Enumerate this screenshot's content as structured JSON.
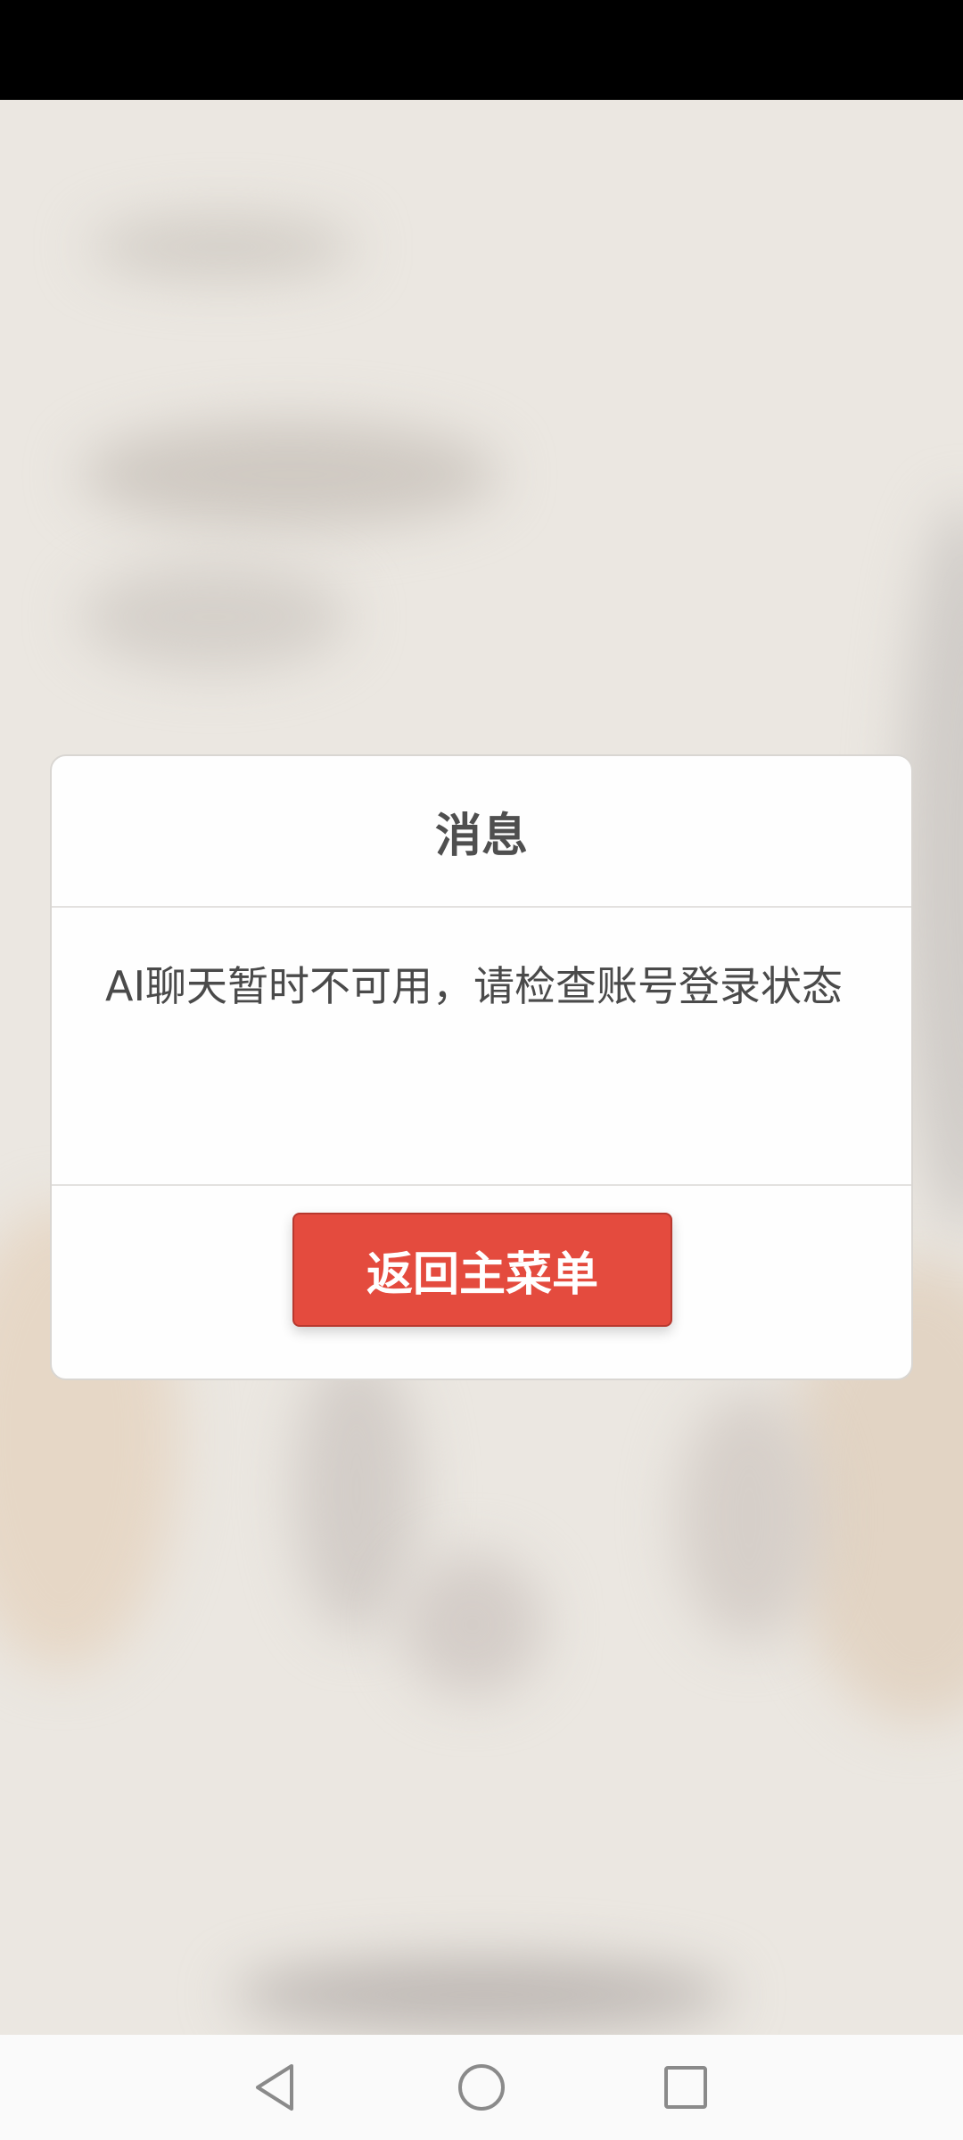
{
  "dialog": {
    "title": "消息",
    "message": "AI聊天暂时不可用，请检查账号登录状态",
    "return_button_label": "返回主菜单"
  },
  "colors": {
    "accent_button": "#e44b3e",
    "status_bar": "#000000",
    "nav_bar": "#fafafa"
  },
  "nav_bar": {
    "icons": [
      "back-icon",
      "home-icon",
      "recents-icon"
    ]
  }
}
